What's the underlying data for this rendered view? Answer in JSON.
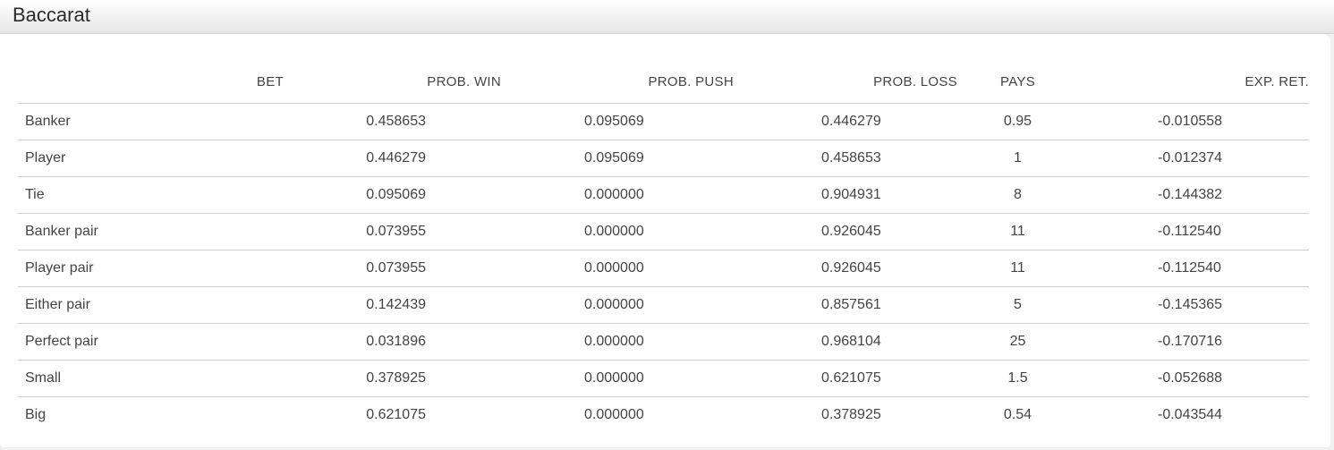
{
  "header": {
    "title": "Baccarat"
  },
  "table": {
    "columns": [
      "BET",
      "PROB. WIN",
      "PROB. PUSH",
      "PROB. LOSS",
      "PAYS",
      "EXP. RET."
    ],
    "rows": [
      {
        "bet": "Banker",
        "win": "0.458653",
        "push": "0.095069",
        "loss": "0.446279",
        "pays": "0.95",
        "exp": "-0.010558"
      },
      {
        "bet": "Player",
        "win": "0.446279",
        "push": "0.095069",
        "loss": "0.458653",
        "pays": "1",
        "exp": "-0.012374"
      },
      {
        "bet": "Tie",
        "win": "0.095069",
        "push": "0.000000",
        "loss": "0.904931",
        "pays": "8",
        "exp": "-0.144382"
      },
      {
        "bet": "Banker pair",
        "win": "0.073955",
        "push": "0.000000",
        "loss": "0.926045",
        "pays": "11",
        "exp": "-0.112540"
      },
      {
        "bet": "Player pair",
        "win": "0.073955",
        "push": "0.000000",
        "loss": "0.926045",
        "pays": "11",
        "exp": "-0.112540"
      },
      {
        "bet": "Either pair",
        "win": "0.142439",
        "push": "0.000000",
        "loss": "0.857561",
        "pays": "5",
        "exp": "-0.145365"
      },
      {
        "bet": "Perfect pair",
        "win": "0.031896",
        "push": "0.000000",
        "loss": "0.968104",
        "pays": "25",
        "exp": "-0.170716"
      },
      {
        "bet": "Small",
        "win": "0.378925",
        "push": "0.000000",
        "loss": "0.621075",
        "pays": "1.5",
        "exp": "-0.052688"
      },
      {
        "bet": "Big",
        "win": "0.621075",
        "push": "0.000000",
        "loss": "0.378925",
        "pays": "0.54",
        "exp": "-0.043544"
      }
    ]
  }
}
